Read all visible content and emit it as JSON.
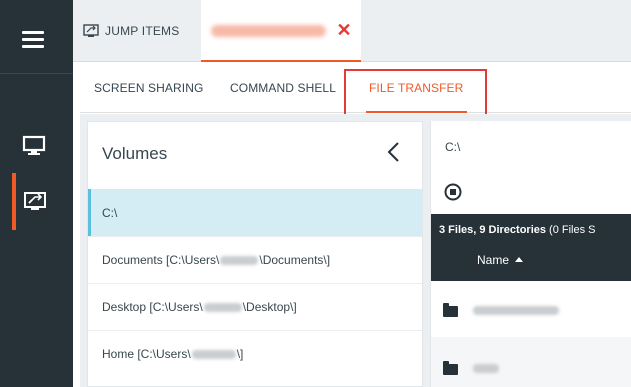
{
  "top_tabs": {
    "jump_items_label": "JUMP ITEMS",
    "close_symbol": "✕"
  },
  "sub_tabs": {
    "screen_sharing": "SCREEN SHARING",
    "command_shell": "COMMAND SHELL",
    "file_transfer": "FILE TRANSFER"
  },
  "volumes": {
    "title": "Volumes",
    "items": [
      {
        "label": "C:\\"
      },
      {
        "prefix": "Documents [C:\\Users\\",
        "suffix": "\\Documents\\]"
      },
      {
        "prefix": "Desktop [C:\\Users\\",
        "suffix": "\\Desktop\\]"
      },
      {
        "prefix": "Home [C:\\Users\\",
        "suffix": "\\]"
      }
    ]
  },
  "files": {
    "path": "C:\\",
    "summary_bold": "3 Files, 9 Directories",
    "summary_rest": " (0 Files S",
    "name_column": "Name"
  },
  "icons": {
    "menu": "hamburger-menu-icon",
    "screen": "monitor-icon",
    "file_transfer": "file-transfer-icon",
    "jump": "jump-items-icon",
    "back": "chevron-left-icon",
    "stop": "stop-circle-icon",
    "folder": "folder-icon"
  },
  "colors": {
    "accent": "#f05a28",
    "rail": "#263238",
    "selected": "#d4ecf4",
    "highlight_box": "#e53935"
  }
}
